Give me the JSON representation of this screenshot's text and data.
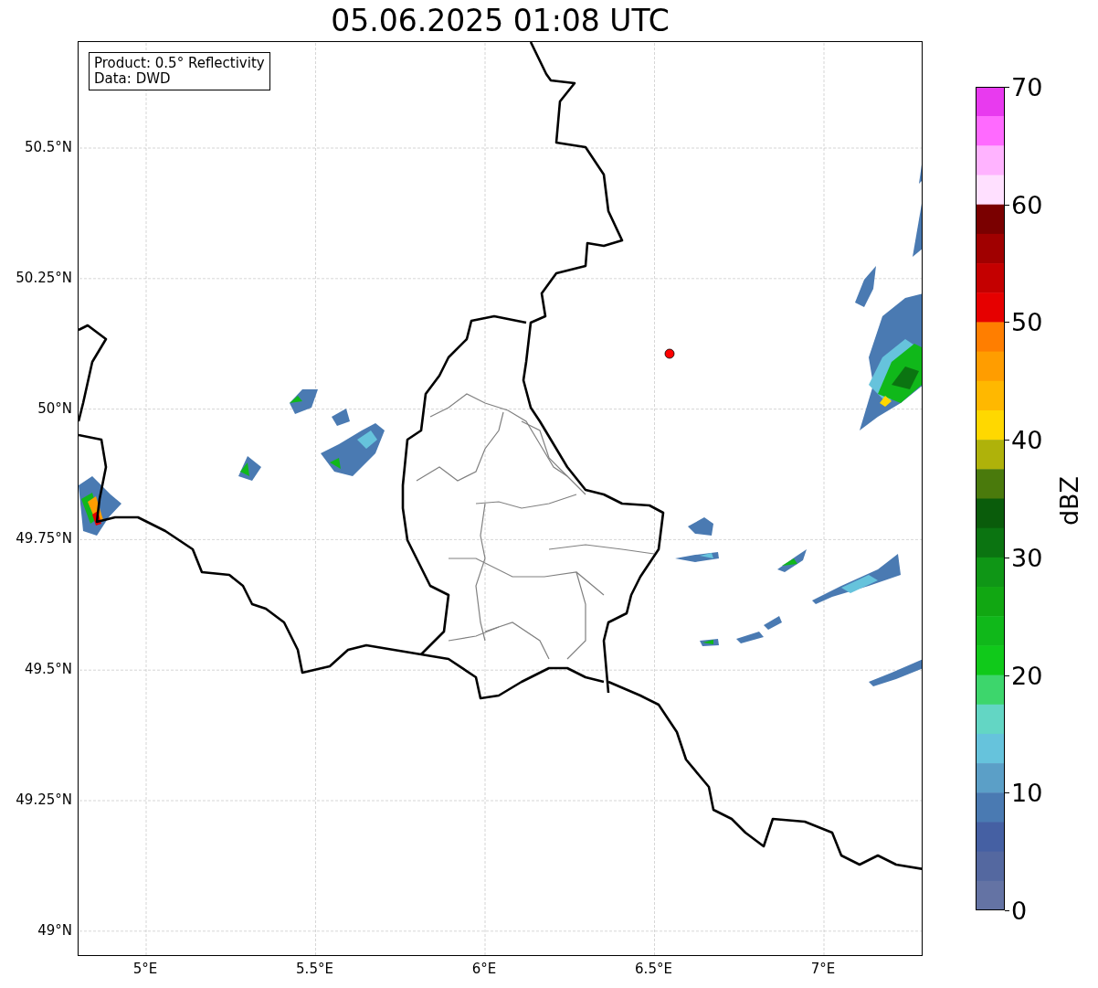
{
  "title": "05.06.2025 01:08 UTC",
  "info_box": {
    "lines": [
      "Product: 0.5° Reflectivity",
      "Data: DWD"
    ]
  },
  "map": {
    "lat_labels": [
      "50.5°N",
      "50.25°N",
      "50°N",
      "49.75°N",
      "49.5°N",
      "49.25°N",
      "49°N"
    ],
    "lon_labels": [
      "5°E",
      "5.5°E",
      "6°E",
      "6.5°E",
      "7°E"
    ]
  },
  "colorbar": {
    "label": "dBZ",
    "ticks": [
      "70",
      "60",
      "50",
      "40",
      "30",
      "20",
      "10",
      "0"
    ],
    "segments": [
      {
        "color": "#e83aef"
      },
      {
        "color": "#ff6aff"
      },
      {
        "color": "#ffb3ff"
      },
      {
        "color": "#ffe0ff"
      },
      {
        "color": "#7a0000"
      },
      {
        "color": "#a00000"
      },
      {
        "color": "#c40000"
      },
      {
        "color": "#e60000"
      },
      {
        "color": "#ff7e00"
      },
      {
        "color": "#ff9d00"
      },
      {
        "color": "#ffb800"
      },
      {
        "color": "#ffd800"
      },
      {
        "color": "#afb20a"
      },
      {
        "color": "#4a7a0c"
      },
      {
        "color": "#0a5c0b"
      },
      {
        "color": "#0b7411"
      },
      {
        "color": "#0f9616"
      },
      {
        "color": "#11a712"
      },
      {
        "color": "#10b81a"
      },
      {
        "color": "#10c91a"
      },
      {
        "color": "#3dd66c"
      },
      {
        "color": "#63d6c4"
      },
      {
        "color": "#66c3dc"
      },
      {
        "color": "#5b9fc7"
      },
      {
        "color": "#4a7ab2"
      },
      {
        "color": "#4560a3"
      },
      {
        "color": "#5468a0"
      },
      {
        "color": "#6473a4"
      }
    ]
  }
}
